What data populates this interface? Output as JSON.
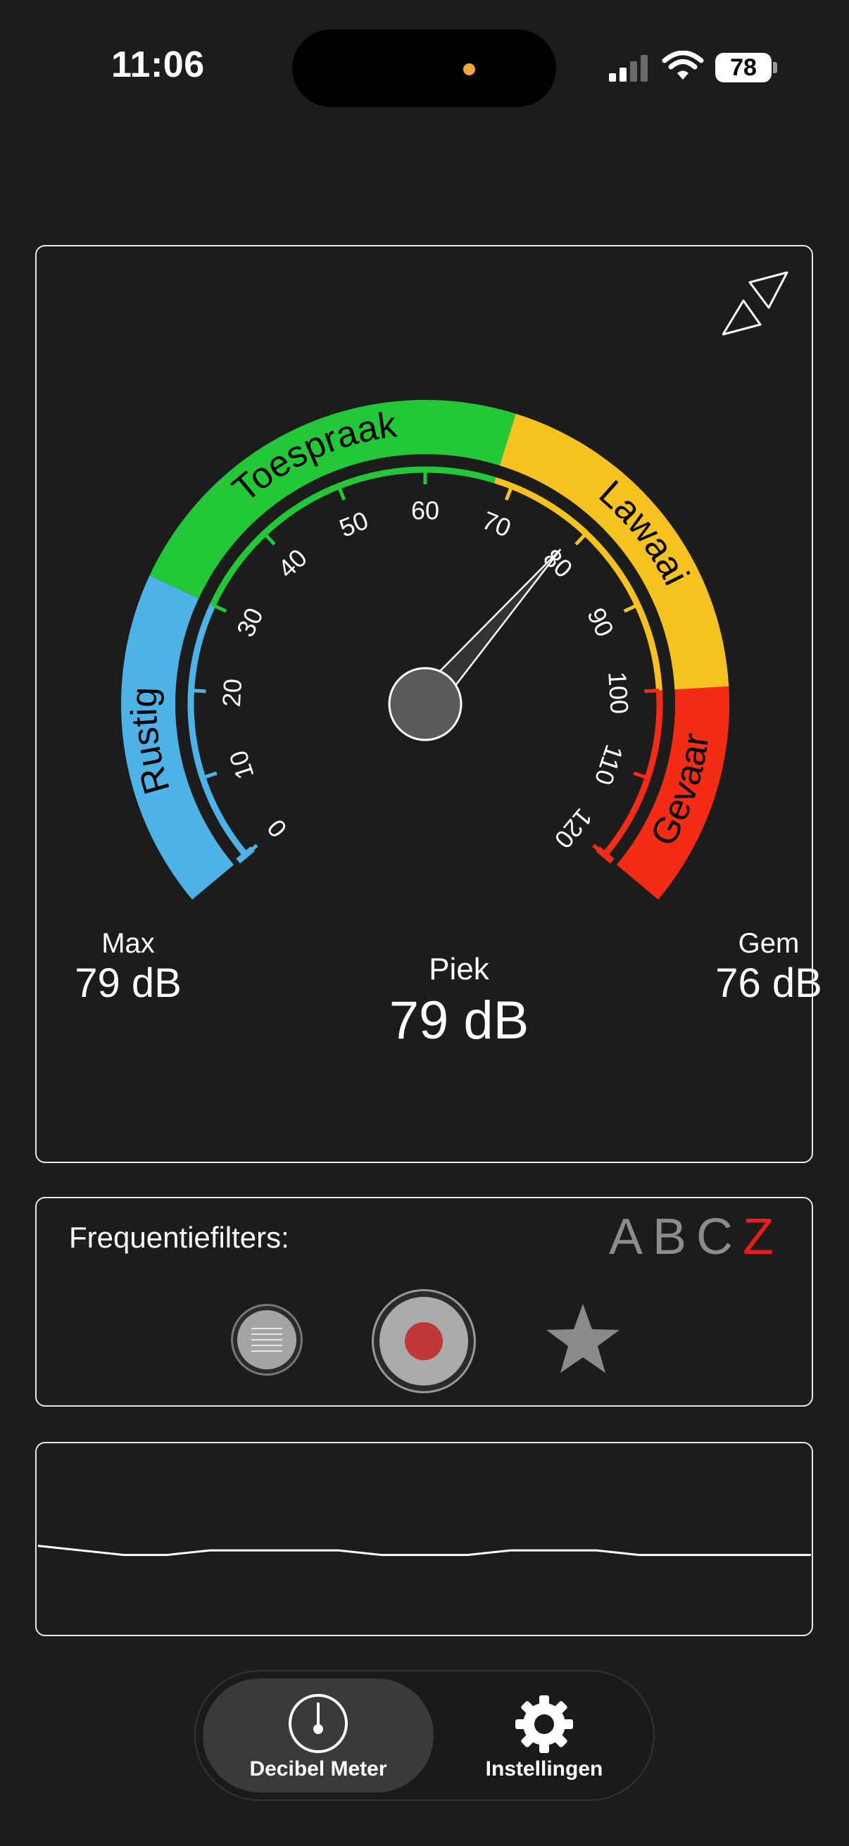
{
  "status_bar": {
    "time": "11:06",
    "battery": "78"
  },
  "gauge": {
    "zones": [
      {
        "label": "Rustig",
        "color": "#4db3e6"
      },
      {
        "label": "Toespraak",
        "color": "#22c837"
      },
      {
        "label": "Lawaai",
        "color": "#f5c220"
      },
      {
        "label": "Gevaar",
        "color": "#f52c15"
      }
    ],
    "scale_min": 0,
    "scale_max": 120,
    "tick_labels": [
      "0",
      "10",
      "20",
      "30",
      "40",
      "50",
      "60",
      "70",
      "80",
      "90",
      "100",
      "110",
      "120"
    ],
    "needle_value": 79
  },
  "stats": {
    "max_label": "Max",
    "max_value": "79 dB",
    "peak_label": "Piek",
    "peak_value": "79 dB",
    "avg_label": "Gem",
    "avg_value": "76 dB"
  },
  "filters": {
    "label": "Frequentiefilters:",
    "options": [
      "A",
      "B",
      "C",
      "Z"
    ],
    "selected": "Z",
    "active_color": "#ee1b1b"
  },
  "history": [
    79,
    78,
    77,
    77,
    78,
    78,
    78,
    78,
    77,
    77,
    77,
    78,
    78,
    78,
    77,
    77,
    77,
    77,
    77
  ],
  "tabs": [
    {
      "label": "Decibel Meter",
      "icon": "gauge-icon",
      "active": true
    },
    {
      "label": "Instellingen",
      "icon": "gear-icon",
      "active": false
    }
  ]
}
